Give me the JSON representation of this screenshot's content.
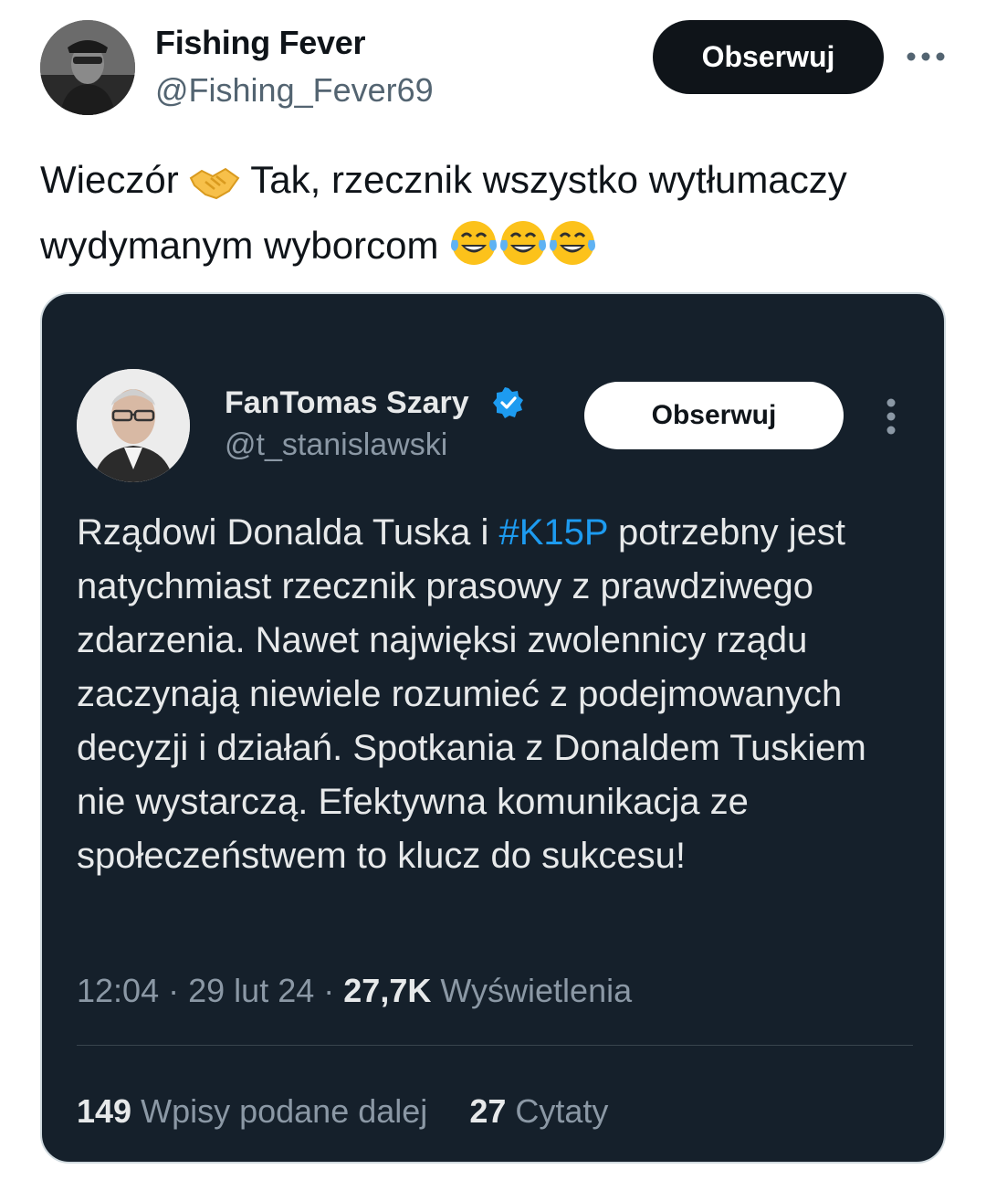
{
  "author": {
    "name": "Fishing Fever",
    "handle": "@Fishing_Fever69",
    "follow_label": "Obserwuj"
  },
  "tweet": {
    "text_part1": "Wieczór",
    "text_part2": "Tak, rzecznik wszystko wytłumaczy wydymanym wyborcom",
    "emojis": [
      "handshake-emoji",
      "tears-of-joy-emoji",
      "tears-of-joy-emoji",
      "tears-of-joy-emoji"
    ]
  },
  "quoted": {
    "name": "FanTomas Szary",
    "handle": "@t_stanislawski",
    "follow_label": "Obserwuj",
    "text_before_tag": "Rządowi Donalda Tuska i ",
    "hashtag": "#K15P",
    "text_after_tag": " potrzebny jest natychmiast rzecznik prasowy z prawdziwego zdarzenia. Nawet najwięksi zwolennicy rządu zaczynają niewiele rozumieć z podejmowanych decyzji i działań. Spotkania z Donaldem Tuskiem nie wystarczą. Efektywna komunikacja ze społeczeństwem to klucz do sukcesu!",
    "time": "12:04",
    "date": "29 lut 24",
    "views_count": "27,7K",
    "views_label": "Wyświetlenia",
    "reposts_count": "149",
    "reposts_label": "Wpisy podane dalej",
    "quotes_count": "27",
    "quotes_label": "Cytaty"
  },
  "colors": {
    "link": "#1d9bf0",
    "card_bg": "#15202b",
    "secondary_text": "#536471"
  }
}
